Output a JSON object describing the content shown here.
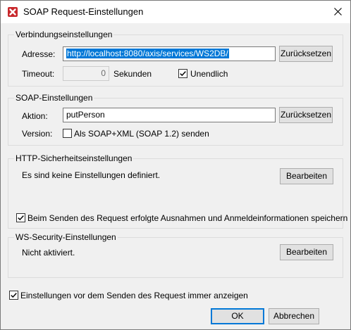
{
  "window": {
    "title": "SOAP Request-Einstellungen",
    "app_icon": "altova-x-icon",
    "close_icon": "close-icon"
  },
  "connection": {
    "group_label": "Verbindungseinstellungen",
    "address_label": "Adresse:",
    "address_value": "http://localhost:8080/axis/services/WS2DB/",
    "reset_label": "Zurücksetzen",
    "timeout_label": "Timeout:",
    "timeout_value": "0",
    "seconds_label": "Sekunden",
    "unlimited_label": "Unendlich",
    "unlimited_checked": true
  },
  "soap": {
    "group_label": "SOAP-Einstellungen",
    "action_label": "Aktion:",
    "action_value": "putPerson",
    "reset_label": "Zurücksetzen",
    "version_label": "Version:",
    "soap12_label": "Als SOAP+XML (SOAP 1.2) senden",
    "soap12_checked": false
  },
  "http_security": {
    "group_label": "HTTP-Sicherheitseinstellungen",
    "status_text": "Es sind keine Einstellungen definiert.",
    "edit_label": "Bearbeiten",
    "save_credentials_label": "Beim Senden des Request erfolgte Ausnahmen und Anmeldeinformationen speichern",
    "save_credentials_checked": true
  },
  "ws_security": {
    "group_label": "WS-Security-Einstellungen",
    "status_text": "Nicht aktiviert.",
    "edit_label": "Bearbeiten"
  },
  "footer": {
    "always_show_label": "Einstellungen vor dem Senden des Request immer anzeigen",
    "always_show_checked": true,
    "ok_label": "OK",
    "cancel_label": "Abbrechen"
  }
}
